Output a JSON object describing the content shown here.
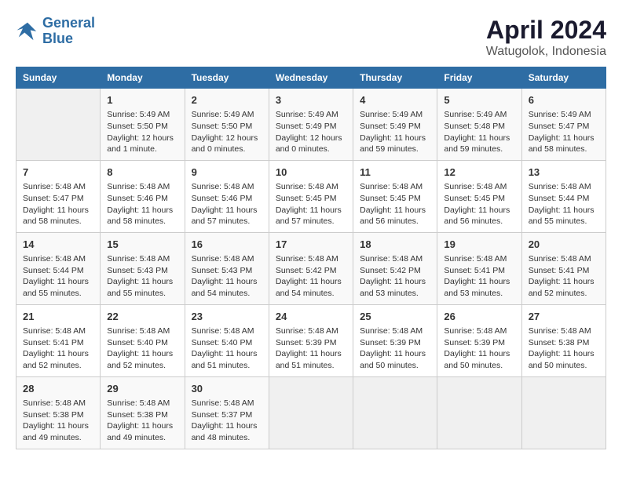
{
  "header": {
    "logo_line1": "General",
    "logo_line2": "Blue",
    "month": "April 2024",
    "location": "Watugolok, Indonesia"
  },
  "days_of_week": [
    "Sunday",
    "Monday",
    "Tuesday",
    "Wednesday",
    "Thursday",
    "Friday",
    "Saturday"
  ],
  "weeks": [
    [
      {
        "day": "",
        "info": ""
      },
      {
        "day": "1",
        "info": "Sunrise: 5:49 AM\nSunset: 5:50 PM\nDaylight: 12 hours\nand 1 minute."
      },
      {
        "day": "2",
        "info": "Sunrise: 5:49 AM\nSunset: 5:50 PM\nDaylight: 12 hours\nand 0 minutes."
      },
      {
        "day": "3",
        "info": "Sunrise: 5:49 AM\nSunset: 5:49 PM\nDaylight: 12 hours\nand 0 minutes."
      },
      {
        "day": "4",
        "info": "Sunrise: 5:49 AM\nSunset: 5:49 PM\nDaylight: 11 hours\nand 59 minutes."
      },
      {
        "day": "5",
        "info": "Sunrise: 5:49 AM\nSunset: 5:48 PM\nDaylight: 11 hours\nand 59 minutes."
      },
      {
        "day": "6",
        "info": "Sunrise: 5:49 AM\nSunset: 5:47 PM\nDaylight: 11 hours\nand 58 minutes."
      }
    ],
    [
      {
        "day": "7",
        "info": "Sunrise: 5:48 AM\nSunset: 5:47 PM\nDaylight: 11 hours\nand 58 minutes."
      },
      {
        "day": "8",
        "info": "Sunrise: 5:48 AM\nSunset: 5:46 PM\nDaylight: 11 hours\nand 58 minutes."
      },
      {
        "day": "9",
        "info": "Sunrise: 5:48 AM\nSunset: 5:46 PM\nDaylight: 11 hours\nand 57 minutes."
      },
      {
        "day": "10",
        "info": "Sunrise: 5:48 AM\nSunset: 5:45 PM\nDaylight: 11 hours\nand 57 minutes."
      },
      {
        "day": "11",
        "info": "Sunrise: 5:48 AM\nSunset: 5:45 PM\nDaylight: 11 hours\nand 56 minutes."
      },
      {
        "day": "12",
        "info": "Sunrise: 5:48 AM\nSunset: 5:45 PM\nDaylight: 11 hours\nand 56 minutes."
      },
      {
        "day": "13",
        "info": "Sunrise: 5:48 AM\nSunset: 5:44 PM\nDaylight: 11 hours\nand 55 minutes."
      }
    ],
    [
      {
        "day": "14",
        "info": "Sunrise: 5:48 AM\nSunset: 5:44 PM\nDaylight: 11 hours\nand 55 minutes."
      },
      {
        "day": "15",
        "info": "Sunrise: 5:48 AM\nSunset: 5:43 PM\nDaylight: 11 hours\nand 55 minutes."
      },
      {
        "day": "16",
        "info": "Sunrise: 5:48 AM\nSunset: 5:43 PM\nDaylight: 11 hours\nand 54 minutes."
      },
      {
        "day": "17",
        "info": "Sunrise: 5:48 AM\nSunset: 5:42 PM\nDaylight: 11 hours\nand 54 minutes."
      },
      {
        "day": "18",
        "info": "Sunrise: 5:48 AM\nSunset: 5:42 PM\nDaylight: 11 hours\nand 53 minutes."
      },
      {
        "day": "19",
        "info": "Sunrise: 5:48 AM\nSunset: 5:41 PM\nDaylight: 11 hours\nand 53 minutes."
      },
      {
        "day": "20",
        "info": "Sunrise: 5:48 AM\nSunset: 5:41 PM\nDaylight: 11 hours\nand 52 minutes."
      }
    ],
    [
      {
        "day": "21",
        "info": "Sunrise: 5:48 AM\nSunset: 5:41 PM\nDaylight: 11 hours\nand 52 minutes."
      },
      {
        "day": "22",
        "info": "Sunrise: 5:48 AM\nSunset: 5:40 PM\nDaylight: 11 hours\nand 52 minutes."
      },
      {
        "day": "23",
        "info": "Sunrise: 5:48 AM\nSunset: 5:40 PM\nDaylight: 11 hours\nand 51 minutes."
      },
      {
        "day": "24",
        "info": "Sunrise: 5:48 AM\nSunset: 5:39 PM\nDaylight: 11 hours\nand 51 minutes."
      },
      {
        "day": "25",
        "info": "Sunrise: 5:48 AM\nSunset: 5:39 PM\nDaylight: 11 hours\nand 50 minutes."
      },
      {
        "day": "26",
        "info": "Sunrise: 5:48 AM\nSunset: 5:39 PM\nDaylight: 11 hours\nand 50 minutes."
      },
      {
        "day": "27",
        "info": "Sunrise: 5:48 AM\nSunset: 5:38 PM\nDaylight: 11 hours\nand 50 minutes."
      }
    ],
    [
      {
        "day": "28",
        "info": "Sunrise: 5:48 AM\nSunset: 5:38 PM\nDaylight: 11 hours\nand 49 minutes."
      },
      {
        "day": "29",
        "info": "Sunrise: 5:48 AM\nSunset: 5:38 PM\nDaylight: 11 hours\nand 49 minutes."
      },
      {
        "day": "30",
        "info": "Sunrise: 5:48 AM\nSunset: 5:37 PM\nDaylight: 11 hours\nand 48 minutes."
      },
      {
        "day": "",
        "info": ""
      },
      {
        "day": "",
        "info": ""
      },
      {
        "day": "",
        "info": ""
      },
      {
        "day": "",
        "info": ""
      }
    ]
  ]
}
